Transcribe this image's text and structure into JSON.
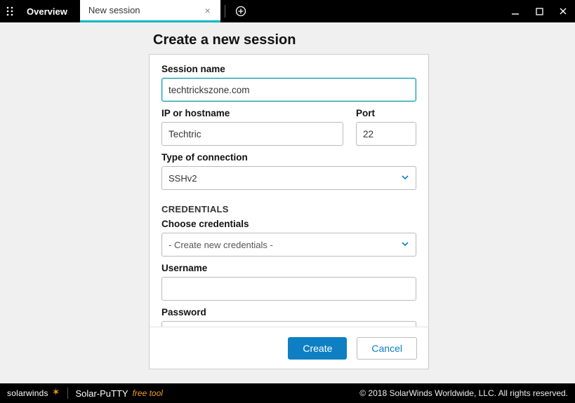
{
  "titlebar": {
    "overview_tab": "Overview",
    "new_session_tab": "New session"
  },
  "dialog": {
    "title": "Create a new session",
    "session_name_label": "Session name",
    "session_name_value": "techtrickszone.com",
    "host_label": "IP or hostname",
    "host_value": "Techtric",
    "port_label": "Port",
    "port_value": "22",
    "conn_type_label": "Type of connection",
    "conn_type_value": "SSHv2",
    "credentials_section": "CREDENTIALS",
    "choose_cred_label": "Choose credentials",
    "choose_cred_value": "- Create new credentials -",
    "username_label": "Username",
    "username_value": "",
    "password_label": "Password",
    "password_value": "",
    "create_btn": "Create",
    "cancel_btn": "Cancel"
  },
  "footer": {
    "brand": "solarwinds",
    "product": "Solar-PuTTY",
    "freetool": "free tool",
    "copyright": "© 2018 SolarWinds Worldwide, LLC. All rights reserved."
  }
}
